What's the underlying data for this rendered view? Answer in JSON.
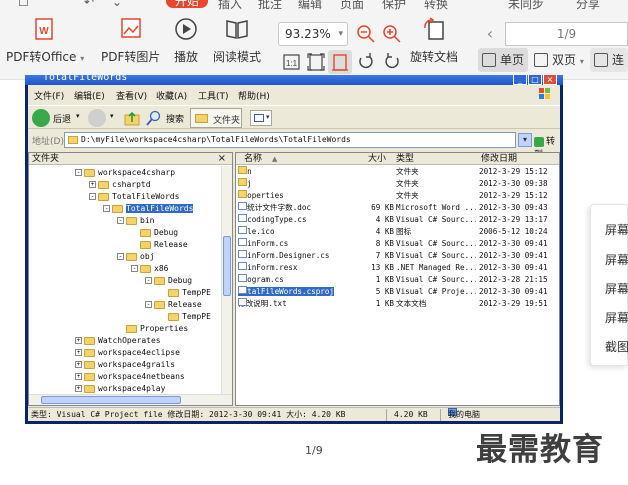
{
  "topstrip": {
    "start_label": "开始",
    "items": [
      "插入",
      "批注",
      "编辑",
      "页面",
      "保护",
      "转换",
      "未同步",
      "分享"
    ]
  },
  "toolbar": {
    "pdf_to_office": "PDF转Office",
    "pdf_to_image": "PDF转图片",
    "play": "播放",
    "read_mode": "阅读模式",
    "zoom": "93.23%",
    "rotate_doc": "旋转文档",
    "page_indicator": "1/9",
    "single_page": "单页",
    "double_page": "双页",
    "continuous": "连"
  },
  "explorer": {
    "title": "TotalFileWords",
    "menu": [
      "文件(F)",
      "编辑(E)",
      "查看(V)",
      "收藏(A)",
      "工具(T)",
      "帮助(H)"
    ],
    "back_label": "后退",
    "search_label": "搜索",
    "folders_label": "文件夹",
    "address_label": "地址(D)",
    "address_path": "D:\\myFile\\workspace4csharp\\TotalFileWords\\TotalFileWords",
    "go_label": "转到",
    "tree_header": "文件夹",
    "tree": [
      {
        "label": "workspace4csharp",
        "sign": "-"
      },
      {
        "label": "csharptd",
        "sign": "+"
      },
      {
        "label": "TotalFileWords",
        "sign": "-"
      },
      {
        "label": "TotalFileWords",
        "sign": "-",
        "selected": true
      },
      {
        "label": "bin",
        "sign": "-"
      },
      {
        "label": "Debug",
        "sign": ""
      },
      {
        "label": "Release",
        "sign": ""
      },
      {
        "label": "obj",
        "sign": "-"
      },
      {
        "label": "x86",
        "sign": "-"
      },
      {
        "label": "Debug",
        "sign": "-"
      },
      {
        "label": "TempPE",
        "sign": ""
      },
      {
        "label": "Release",
        "sign": "-"
      },
      {
        "label": "TempPE",
        "sign": ""
      },
      {
        "label": "Properties",
        "sign": ""
      },
      {
        "label": "WatchOperates",
        "sign": "+"
      },
      {
        "label": "workspace4eclipse",
        "sign": "+"
      },
      {
        "label": "workspace4grails",
        "sign": "+"
      },
      {
        "label": "workspace4netbeans",
        "sign": "+"
      },
      {
        "label": "workspace4play",
        "sign": "+"
      }
    ],
    "columns": {
      "name": "名称",
      "size": "大小",
      "type": "类型",
      "date": "修改日期"
    },
    "files": [
      {
        "name": "bin",
        "size": "",
        "type": "文件夹",
        "date": "2012-3-29 15:12",
        "kind": "folder"
      },
      {
        "name": "obj",
        "size": "",
        "type": "文件夹",
        "date": "2012-3-30 09:38",
        "kind": "folder"
      },
      {
        "name": "Properties",
        "size": "",
        "type": "文件夹",
        "date": "2012-3-29 15:12",
        "kind": "folder"
      },
      {
        "name": "C#统计文件字数.doc",
        "size": "69 KB",
        "type": "Microsoft Word ...",
        "date": "2012-3-30 09:43",
        "kind": "file"
      },
      {
        "name": "EncodingType.cs",
        "size": "4 KB",
        "type": "Visual C# Sourc...",
        "date": "2012-3-29 13:17",
        "kind": "file"
      },
      {
        "name": "file.ico",
        "size": "4 KB",
        "type": "图标",
        "date": "2006-5-12 10:24",
        "kind": "file"
      },
      {
        "name": "MainForm.cs",
        "size": "8 KB",
        "type": "Visual C# Sourc...",
        "date": "2012-3-30 09:41",
        "kind": "file"
      },
      {
        "name": "MainForm.Designer.cs",
        "size": "7 KB",
        "type": "Visual C# Sourc...",
        "date": "2012-3-30 09:41",
        "kind": "file"
      },
      {
        "name": "MainForm.resx",
        "size": "13 KB",
        "type": ".NET Managed Re...",
        "date": "2012-3-30 09:41",
        "kind": "file"
      },
      {
        "name": "Program.cs",
        "size": "1 KB",
        "type": "Visual C# Sourc...",
        "date": "2012-3-28 21:15",
        "kind": "file"
      },
      {
        "name": "TotalFileWords.csproj",
        "size": "5 KB",
        "type": "Visual C# Proje...",
        "date": "2012-3-30 09:41",
        "kind": "file",
        "selected": true
      },
      {
        "name": "修改说明.txt",
        "size": "1 KB",
        "type": "文本文档",
        "date": "2012-3-29 19:51",
        "kind": "file"
      }
    ],
    "status_text": "类型: Visual C# Project file 修改日期: 2012-3-30 09:41 大小: 4.20 KB",
    "status_size": "4.20 KB",
    "status_location": "我的电脑"
  },
  "page_number": "1/9",
  "watermark": "最需教育",
  "side_menu": [
    "屏幕",
    "屏幕",
    "屏幕",
    "屏幕",
    "截图"
  ],
  "colors": {
    "accent": "#e8452c",
    "xp_title": "#1f56c8",
    "selection": "#316ac5"
  }
}
